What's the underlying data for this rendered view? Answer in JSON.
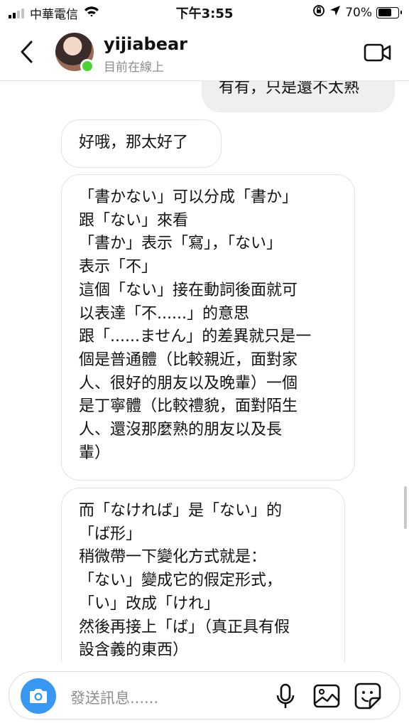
{
  "status_bar": {
    "carrier": "中華電信",
    "time": "下午3:55",
    "battery": "70%",
    "battery_level": 0.7
  },
  "header": {
    "username": "yijiabear",
    "status": "目前在線上",
    "icons": [
      "back-chevron-icon",
      "avatar",
      "video-call-icon"
    ]
  },
  "messages": [
    {
      "side": "out",
      "lines": [
        "有有，只是還不太熟"
      ]
    },
    {
      "side": "in",
      "lines": [
        "好哦，那太好了"
      ]
    },
    {
      "side": "in",
      "lines": [
        "「書かない」可以分成「書か」",
        "跟「ない」來看",
        "「書か」表示「寫」，「ない」",
        "表示「不」",
        "這個「ない」接在動詞後面就可",
        "以表達「不......」的意思",
        "跟「......ません」的差異就只是一",
        "個是普通體（比較親近，面對家",
        "人、很好的朋友以及晚輩）一個",
        "是丁寧體（比較禮貌，面對陌生",
        "人、還沒那麼熟的朋友以及長",
        "輩）"
      ]
    },
    {
      "side": "in",
      "lines": [
        "而「なければ」是「ない」的",
        "「ば形」",
        "稍微帶一下變化方式就是：",
        "「ない」變成它的假定形式，",
        "「い」改成「けれ」",
        "然後再接上「ば」（真正具有假",
        "設含義的東西）"
      ]
    }
  ],
  "composer": {
    "placeholder": "發送訊息......",
    "icons": [
      "camera-icon",
      "microphone-icon",
      "gallery-icon",
      "sticker-icon"
    ]
  },
  "colors": {
    "accent": "#3897f0",
    "online": "#4cd137",
    "outgoing_bubble": "#efefef",
    "secondary_text": "#8e8e8e"
  }
}
